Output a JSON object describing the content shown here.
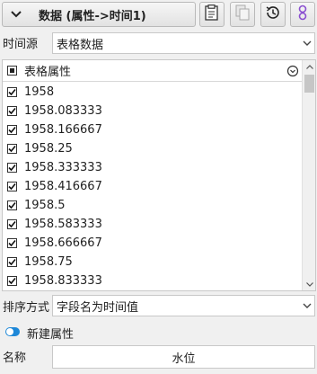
{
  "header": {
    "title": "数据 (属性->时间1)",
    "tools": [
      {
        "name": "paste-icon"
      },
      {
        "name": "copy-icon"
      },
      {
        "name": "history-icon"
      },
      {
        "name": "link-icon"
      }
    ]
  },
  "time_source": {
    "label": "时间源",
    "value": "表格数据"
  },
  "attribute_list": {
    "header_label": "表格属性",
    "items": [
      {
        "label": "1958",
        "checked": true
      },
      {
        "label": "1958.083333",
        "checked": true
      },
      {
        "label": "1958.166667",
        "checked": true
      },
      {
        "label": "1958.25",
        "checked": true
      },
      {
        "label": "1958.333333",
        "checked": true
      },
      {
        "label": "1958.416667",
        "checked": true
      },
      {
        "label": "1958.5",
        "checked": true
      },
      {
        "label": "1958.583333",
        "checked": true
      },
      {
        "label": "1958.666667",
        "checked": true
      },
      {
        "label": "1958.75",
        "checked": true
      },
      {
        "label": "1958.833333",
        "checked": true
      }
    ]
  },
  "sort": {
    "label": "排序方式",
    "value": "字段名为时间值"
  },
  "new_attribute": {
    "label": "新建属性",
    "enabled": true
  },
  "name": {
    "label": "名称",
    "value": "水位"
  },
  "colors": {
    "accent": "#1e88d8"
  }
}
